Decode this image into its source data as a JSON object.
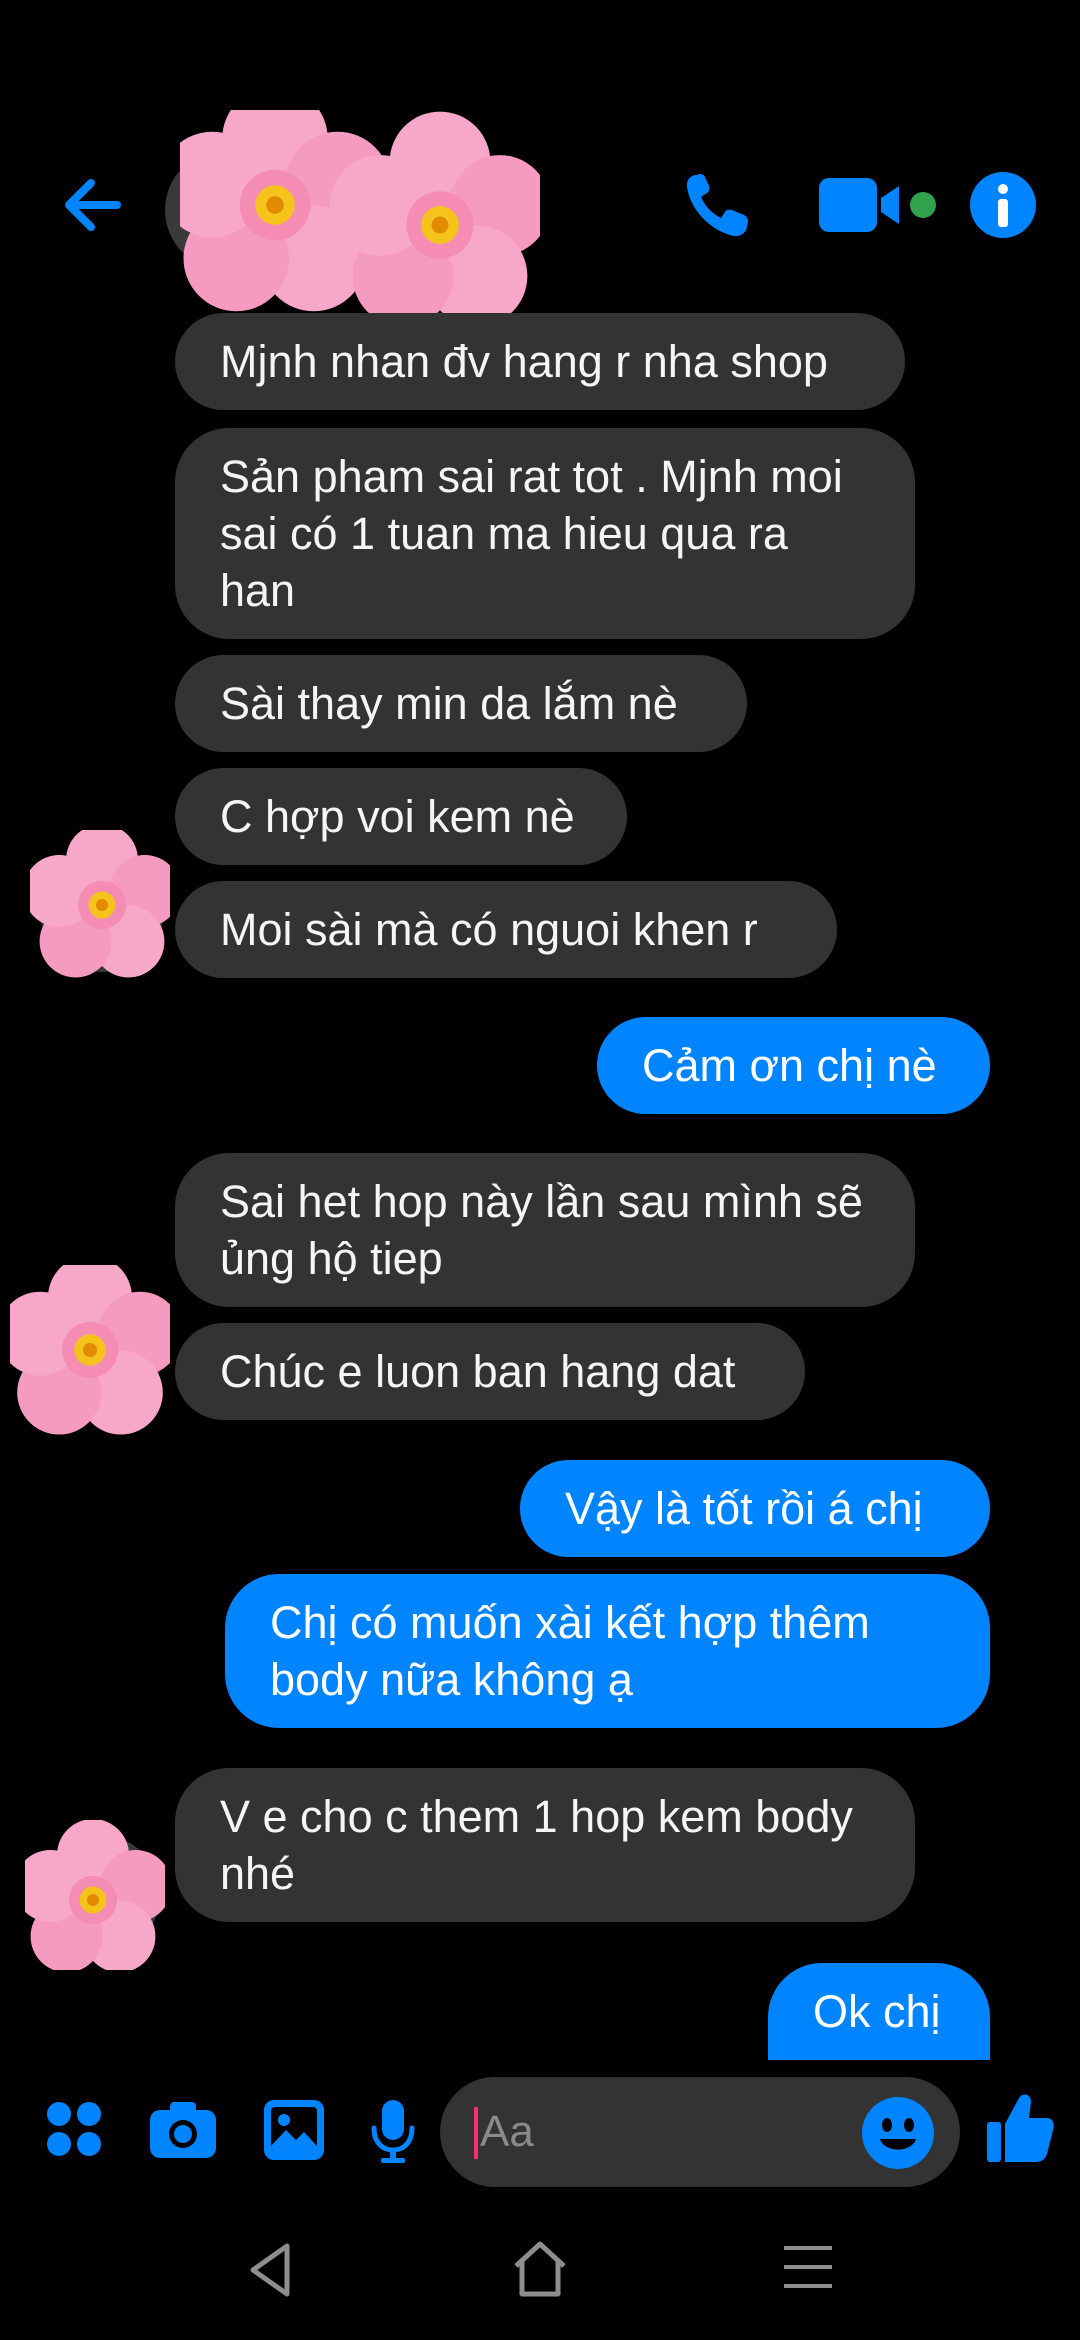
{
  "header": {
    "back_icon": "arrow-left-icon",
    "call_icon": "phone-icon",
    "video_icon": "video-camera-icon",
    "info_icon": "info-icon",
    "accent": "#0084ff",
    "online_dot": "#31a24c"
  },
  "messages": [
    {
      "sender": "them",
      "text": "Mjnh nhan đv hang r nha shop"
    },
    {
      "sender": "them",
      "text": "Sản pham sai rat tot . Mjnh moi sai có 1 tuan ma hieu qua ra han"
    },
    {
      "sender": "them",
      "text": "Sài thay min da lắm nè"
    },
    {
      "sender": "them",
      "text": "C hợp voi kem nè"
    },
    {
      "sender": "them",
      "text": "Moi sài mà có nguoi khen r"
    },
    {
      "sender": "me",
      "text": "Cảm ơn chị nè"
    },
    {
      "sender": "them",
      "text": "Sai het hop này lần sau mình sẽ ủng hộ tiep"
    },
    {
      "sender": "them",
      "text": "Chúc e luon ban hang dat"
    },
    {
      "sender": "me",
      "text": "Vậy là tốt rồi á chị"
    },
    {
      "sender": "me",
      "text": "Chị có muốn xài kết hợp thêm body nữa không ạ"
    },
    {
      "sender": "them",
      "text": "V e cho c them 1 hop kem body nhé"
    },
    {
      "sender": "me",
      "text": "Ok chị"
    }
  ],
  "composer": {
    "placeholder": "Aa",
    "apps_icon": "grid-icon",
    "camera_icon": "camera-icon",
    "gallery_icon": "image-icon",
    "mic_icon": "microphone-icon",
    "emoji_icon": "emoji-icon",
    "like_icon": "thumbs-up-icon"
  },
  "navbar": {
    "back_icon": "nav-back-icon",
    "home_icon": "nav-home-icon",
    "menu_icon": "nav-menu-icon"
  }
}
